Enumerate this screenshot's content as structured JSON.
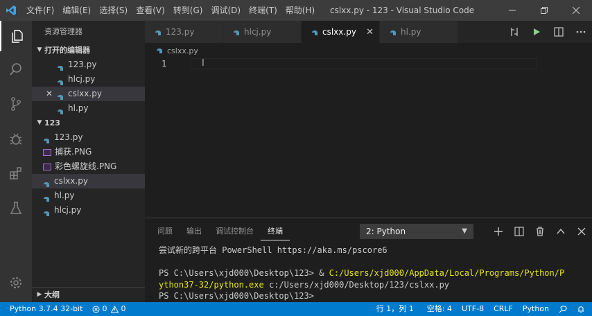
{
  "titlebar": {
    "menu": [
      "文件(F)",
      "编辑(E)",
      "选择(S)",
      "查看(V)",
      "转到(G)",
      "调试(D)",
      "终端(T)",
      "帮助(H)"
    ],
    "window_title": "cslxx.py - 123 - Visual Studio Code"
  },
  "sidebar": {
    "title": "资源管理器",
    "open_editors_label": "打开的编辑器",
    "open_editors": [
      "123.py",
      "hlcj.py",
      "cslxx.py",
      "hl.py"
    ],
    "folder_label": "123",
    "files": [
      {
        "name": "123.py",
        "icon": "python-file-icon"
      },
      {
        "name": "捕获.PNG",
        "icon": "image-file-icon"
      },
      {
        "name": "彩色螺旋线.PNG",
        "icon": "image-file-icon"
      },
      {
        "name": "cslxx.py",
        "icon": "python-file-icon"
      },
      {
        "name": "hl.py",
        "icon": "python-file-icon"
      },
      {
        "name": "hlcj.py",
        "icon": "python-file-icon"
      }
    ],
    "outline_label": "大纲"
  },
  "tabs": [
    {
      "label": "123.py"
    },
    {
      "label": "hlcj.py"
    },
    {
      "label": "cslxx.py"
    },
    {
      "label": "hl.py"
    }
  ],
  "editor": {
    "breadcrumb": "cslxx.py",
    "line_number": "1"
  },
  "panel": {
    "tabs": [
      "问题",
      "输出",
      "调试控制台",
      "终端"
    ],
    "terminal_select": "2: Python",
    "terminal": {
      "line1": "尝试新的跨平台 PowerShell https://aka.ms/pscore6",
      "prompt1": "PS C:\\Users\\xjd000\\Desktop\\123> & ",
      "cmd_path_a": "C:/Users/xjd000/AppData/Local/Programs/Python/P",
      "cmd_path_b": "ython37-32/python.exe",
      "cmd_arg": " c:/Users/xjd000/Desktop/123/cslxx.py",
      "prompt2": "PS C:\\Users\\xjd000\\Desktop\\123>"
    }
  },
  "statusbar": {
    "interpreter": "Python 3.7.4 32-bit",
    "errors": "0",
    "warnings": "0",
    "position": "行 1，列 1",
    "spaces": "空格: 4",
    "encoding": "UTF-8",
    "eol": "CRLF",
    "language": "Python"
  },
  "colors": {
    "accent": "#007acc",
    "python_icon": "#519aba",
    "terminal_path": "#e5e510"
  }
}
